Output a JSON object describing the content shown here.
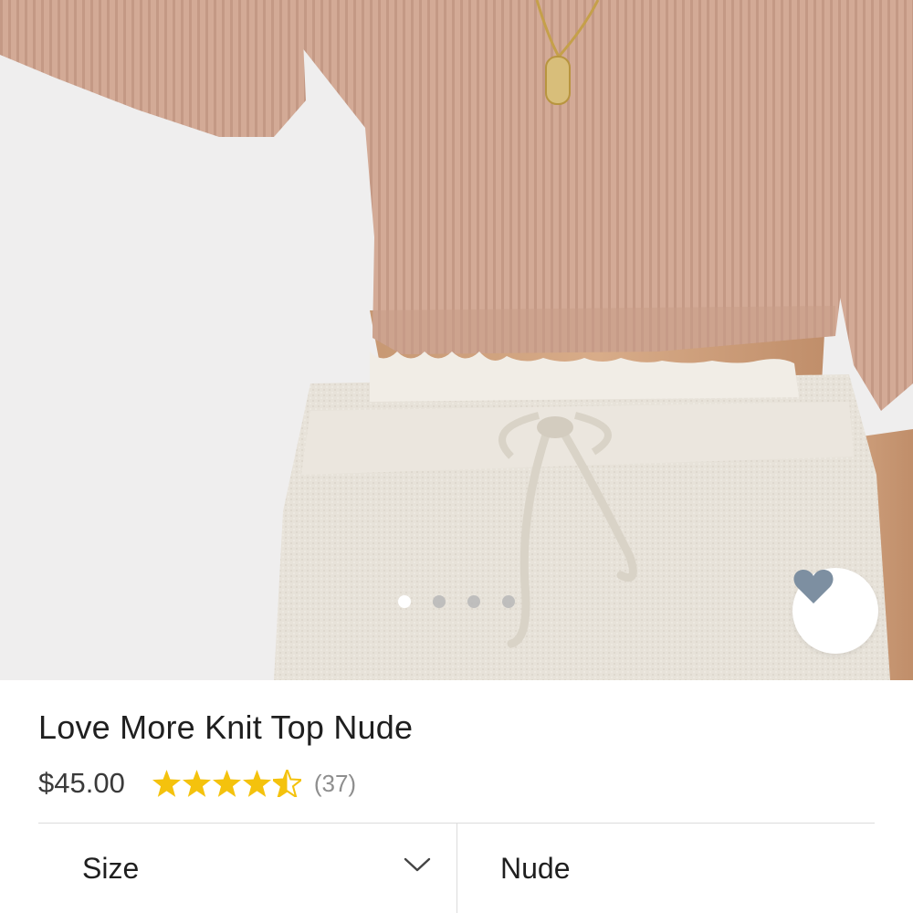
{
  "gallery": {
    "image_alt": "Model wearing a ribbed crop knit top with linen drawstring shorts",
    "dots": [
      {
        "active": true
      },
      {
        "active": false
      },
      {
        "active": false
      },
      {
        "active": false
      }
    ],
    "favorite_icon": "heart-icon",
    "favorite_color": "#7d8fa1"
  },
  "product": {
    "title": "Love More Knit Top Nude",
    "price": "$45.00",
    "rating": 4.5,
    "rating_max": 5,
    "review_count": "(37)",
    "star_color": "#f4c20d"
  },
  "options": {
    "size_label": "Size",
    "color_label": "Nude",
    "dropdown_icon": "chevron-down-icon"
  }
}
